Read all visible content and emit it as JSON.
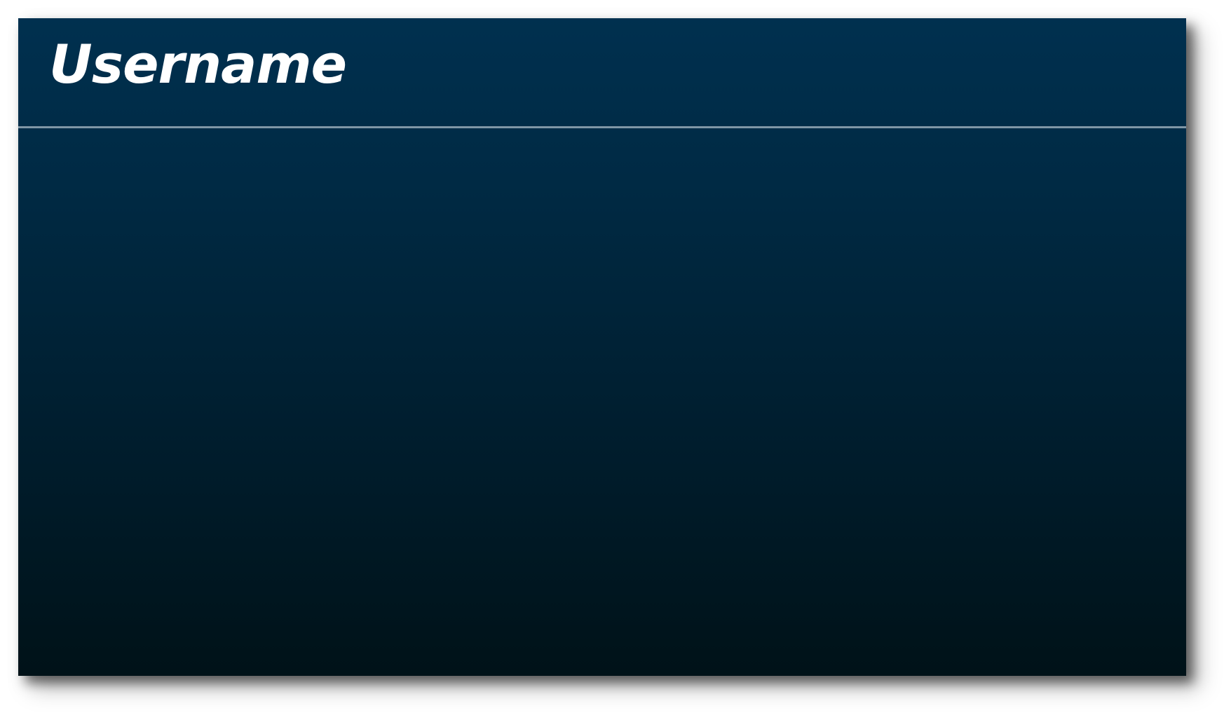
{
  "panel": {
    "title": "Username"
  },
  "colors": {
    "panel_top": "#00304f",
    "panel_bottom": "#001218",
    "divider": "#7f96a6",
    "title_text": "#ffffff"
  }
}
